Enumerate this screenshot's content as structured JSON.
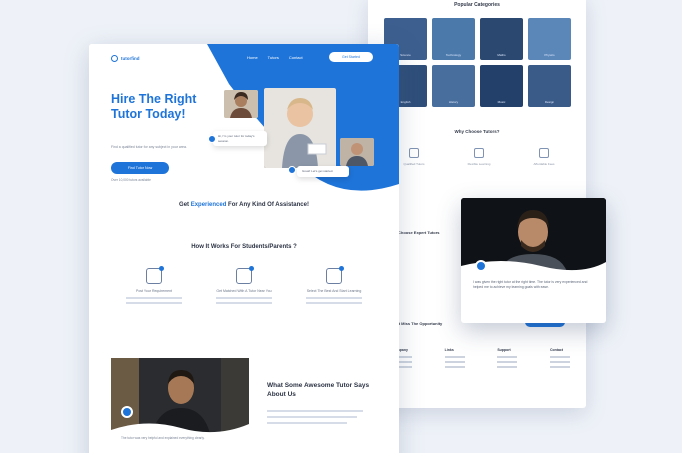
{
  "back_page": {
    "categories_title": "Popular Categories",
    "categories": [
      {
        "label": "Science",
        "color": "#3c5f8f"
      },
      {
        "label": "Technology",
        "color": "#4a79aa"
      },
      {
        "label": "Maths",
        "color": "#2a4870"
      },
      {
        "label": "Physics",
        "color": "#5b86b8"
      },
      {
        "label": "English",
        "color": "#2f4f7a"
      },
      {
        "label": "History",
        "color": "#486e9e"
      },
      {
        "label": "Music",
        "color": "#23406a"
      },
      {
        "label": "Design",
        "color": "#3a5a88"
      }
    ],
    "why_title": "Why Choose Tutors?",
    "why_items": [
      "Qualified Tutors",
      "Flexible Learning",
      "Affordable Fees"
    ],
    "side_text": "Choose Expert Tutors",
    "cta_line": "Don't Miss The Opportunity",
    "footer": [
      "Company",
      "Links",
      "Support",
      "Contact"
    ]
  },
  "popout": {
    "quote": "I was given the right tutor at the right time. The tutor is very experienced and helped me to achieve my learning goals with ease."
  },
  "front_page": {
    "logo_text": "tutorfind",
    "nav": [
      "Home",
      "Tutors",
      "Contact"
    ],
    "nav_button": "Get Started",
    "headline": "Hire The Right Tutor Today!",
    "subline": "Find a qualified tutor for any subject in your area.",
    "hero_button": "Find Tutor Now",
    "hero_note": "Over 10,000 tutors available",
    "bubble_1": "Hi, I'm your tutor for today's session.",
    "bubble_2": "Great! Let's get started.",
    "cta_prefix": "Get ",
    "cta_highlight": "Experienced",
    "cta_suffix": " For Any Kind Of Assistance!",
    "how_title": "How It Works For Students/Parents ?",
    "steps": [
      "Post Your Requirement",
      "Get Matched With A Tutor Near You",
      "Select The Best And Start Learning"
    ],
    "tutor_quote": "The tutor was very helpful and explained everything clearly.",
    "say_title": "What Some Awesome Tutor Says About Us"
  },
  "colors": {
    "accent": "#1e74d9",
    "heading": "#2c3344"
  }
}
